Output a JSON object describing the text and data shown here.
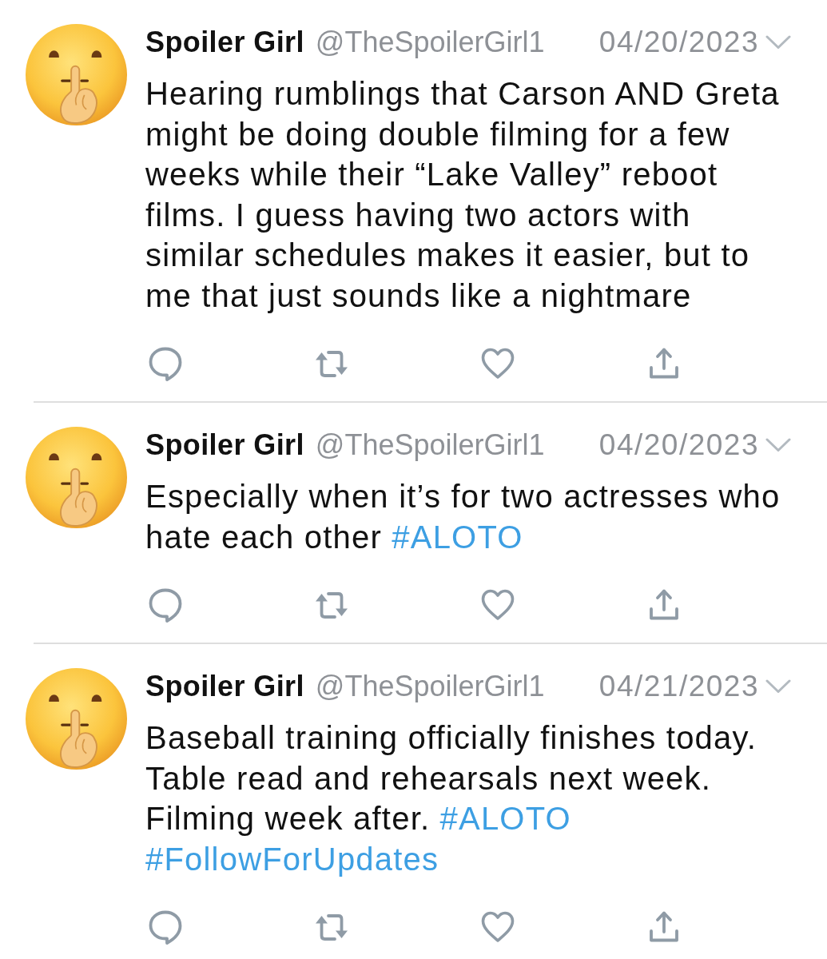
{
  "tweets": [
    {
      "author": {
        "name": "Spoiler Girl",
        "handle": "@TheSpoilerGirl1"
      },
      "date": "04/20/2023",
      "body": [
        {
          "kind": "text",
          "text": "Hearing rumblings that Carson AND Greta might be doing double filming for a few weeks while their “Lake Valley” reboot films. I guess having two actors with similar schedules makes it easier, but to me that just sounds like a nightmare"
        }
      ],
      "actions": [
        {
          "kind": "reply"
        },
        {
          "kind": "retweet"
        },
        {
          "kind": "like",
          "selected": false
        },
        {
          "kind": "share"
        }
      ]
    },
    {
      "author": {
        "name": "Spoiler Girl",
        "handle": "@TheSpoilerGirl1"
      },
      "date": "04/20/2023",
      "body": [
        {
          "kind": "text",
          "text": "Especially when it’s for two actresses who hate each other"
        },
        {
          "kind": "hashtag",
          "text": "#ALOTO"
        }
      ],
      "actions": [
        {
          "kind": "reply"
        },
        {
          "kind": "retweet"
        },
        {
          "kind": "like",
          "selected": false
        },
        {
          "kind": "share"
        }
      ]
    },
    {
      "author": {
        "name": "Spoiler Girl",
        "handle": "@TheSpoilerGirl1"
      },
      "date": "04/21/2023",
      "body": [
        {
          "kind": "text",
          "text": "Baseball training officially finishes today. Table read and rehearsals next week. Filming week after."
        },
        {
          "kind": "hashtag",
          "text": "#ALOTO"
        },
        {
          "kind": "hashtag",
          "text": "#FollowForUpdates"
        }
      ],
      "actions": [
        {
          "kind": "reply"
        },
        {
          "kind": "retweet"
        },
        {
          "kind": "like",
          "selected": false
        },
        {
          "kind": "share"
        }
      ]
    }
  ]
}
